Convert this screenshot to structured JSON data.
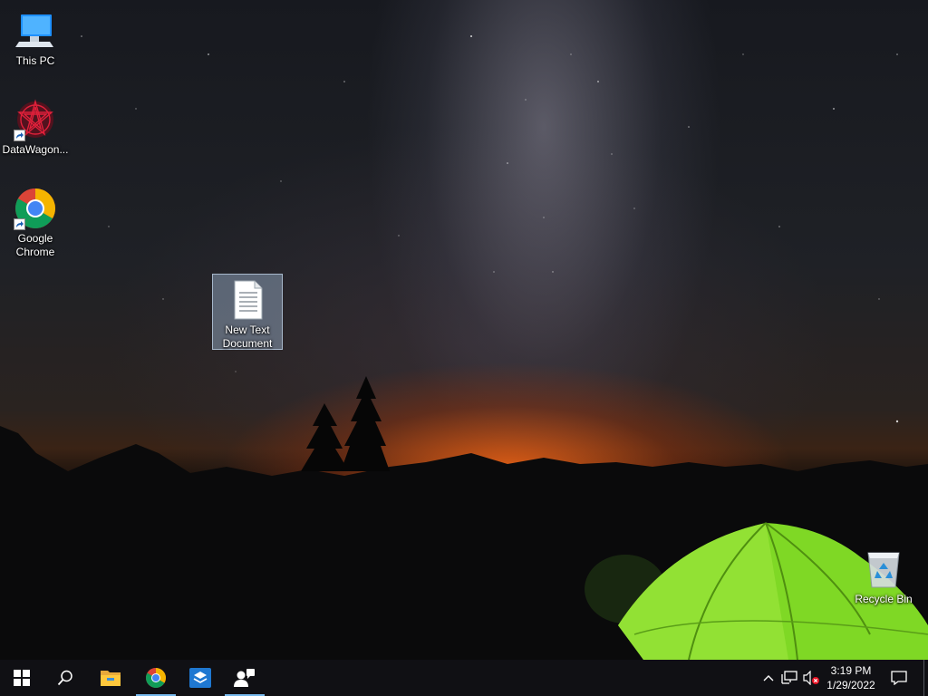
{
  "desktop": {
    "icons": [
      {
        "label": "This PC"
      },
      {
        "label": "DataWagon..."
      },
      {
        "label": "Google\nChrome"
      },
      {
        "label": "New Text\nDocument"
      },
      {
        "label": "Recycle Bin"
      }
    ]
  },
  "taskbar": {
    "start": "windows-logo-icon",
    "search": "search-icon",
    "apps": [
      "file-explorer-icon",
      "chrome-icon",
      "app-box-icon",
      "people-app-icon"
    ],
    "active_apps": [
      "chrome-icon",
      "people-app-icon"
    ],
    "tray": {
      "chevron": "chevron-up-icon",
      "network": "network-icon",
      "volume": "volume-muted-icon",
      "notifications": "action-center-icon"
    },
    "clock": {
      "time": "3:19 PM",
      "date": "1/29/2022"
    }
  },
  "colors": {
    "taskbar_bg": "#101014",
    "active_indicator": "#76b9ed",
    "selection_bg": "#a0b9d2",
    "tent_green": "#8be22a"
  }
}
